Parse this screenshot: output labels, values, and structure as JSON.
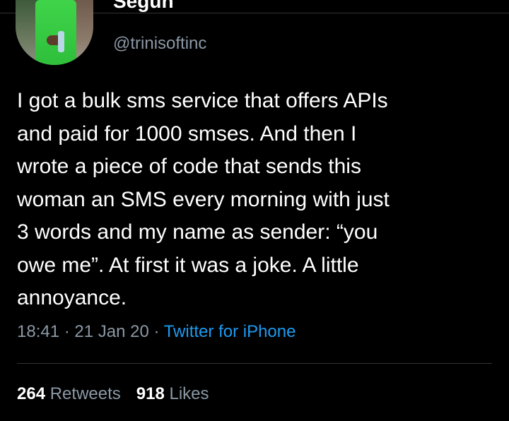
{
  "author": {
    "display_name": "Segun",
    "handle": "@trinisoftinc"
  },
  "tweet": {
    "text": "I got a bulk sms service that offers APIs\nand paid for 1000 smses. And then I\nwrote a piece of code that sends this\nwoman an SMS every morning with just\n3 words and my name as sender: “you\nowe me”. At first it was a joke. A little\nannoyance."
  },
  "meta": {
    "time": "18:41",
    "date": "21 Jan 20",
    "separator": " · ",
    "source": "Twitter for iPhone"
  },
  "stats": {
    "retweets_count": "264",
    "retweets_label": "Retweets",
    "likes_count": "918",
    "likes_label": "Likes"
  },
  "colors": {
    "background": "#000000",
    "primary_text": "#ffffff",
    "secondary_text": "#8b98a5",
    "link": "#1d9bf0",
    "divider": "#2f3336"
  }
}
